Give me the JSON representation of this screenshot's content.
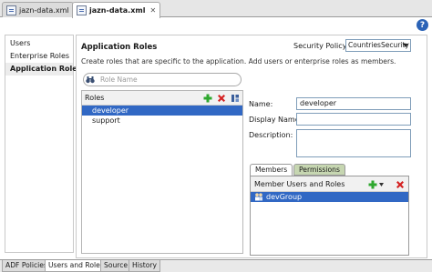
{
  "editor_tabs": [
    {
      "label": "jazn-data.xml",
      "active": false
    },
    {
      "label": "jazn-data.xml",
      "active": true
    }
  ],
  "left_nav": {
    "items": [
      {
        "label": "Users",
        "selected": false
      },
      {
        "label": "Enterprise Roles",
        "selected": false
      },
      {
        "label": "Application Roles",
        "selected": true
      }
    ]
  },
  "main": {
    "title": "Application Roles",
    "description": "Create roles that are specific to the application.  Add users or enterprise roles as members.",
    "security_policy_label": "Security Policy:",
    "security_policy_value": "CountriesSecurity",
    "search_placeholder": "Role Name",
    "roles_header": "Roles",
    "roles": [
      "developer",
      "support"
    ],
    "selected_role_index": 0,
    "fields": {
      "name_label": "Name:",
      "name_value": "developer",
      "display_name_label": "Display Name:",
      "display_name_value": "",
      "description_label": "Description:",
      "description_value": ""
    },
    "sub_tabs": [
      {
        "label": "Members",
        "active": true
      },
      {
        "label": "Permissions",
        "active": false
      }
    ],
    "members_header": "Member Users and Roles",
    "members": [
      "devGroup"
    ]
  },
  "bottom_tabs": [
    {
      "label": "ADF Policies",
      "active": false
    },
    {
      "label": "Users and Roles",
      "active": true
    },
    {
      "label": "Source",
      "active": false
    },
    {
      "label": "History",
      "active": false
    }
  ],
  "colors": {
    "selection": "#3168c4",
    "add_green": "#2ea82e",
    "delete_red": "#d42020",
    "help_blue": "#2b63b7"
  }
}
